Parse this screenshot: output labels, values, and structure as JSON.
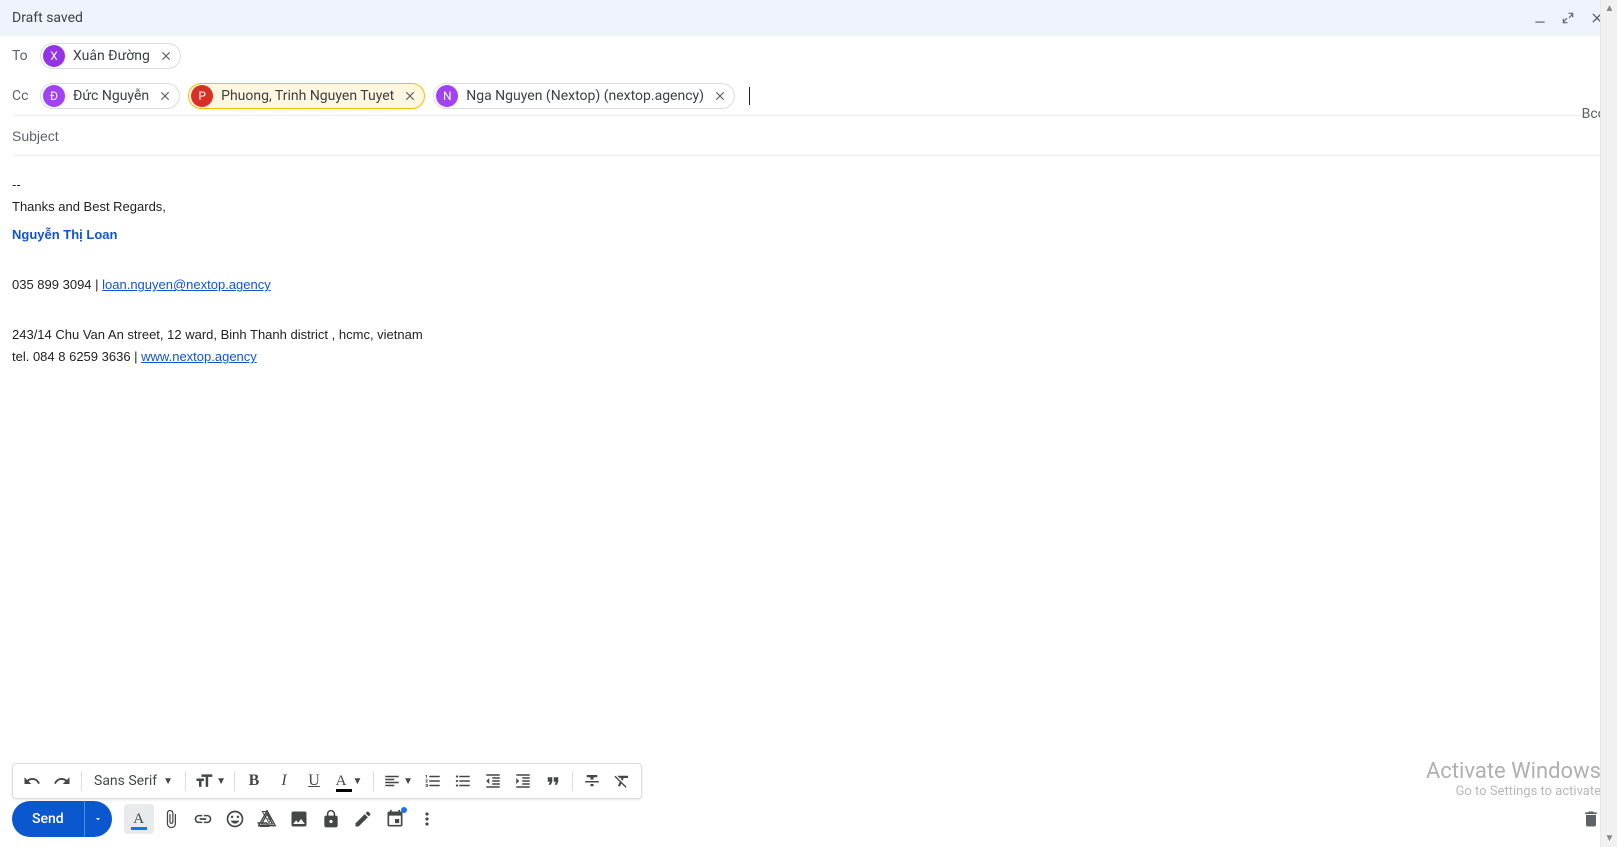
{
  "header": {
    "title": "Draft saved"
  },
  "to": {
    "label": "To",
    "chips": [
      {
        "initial": "X",
        "name": "Xuân Đường",
        "avatar_bg": "#9334e6"
      }
    ]
  },
  "cc": {
    "label": "Cc",
    "chips": [
      {
        "initial": "Đ",
        "name": "Đức Nguyễn",
        "avatar_bg": "#a142f4",
        "highlight": false
      },
      {
        "initial": "P",
        "name": "Phuong, Trinh Nguyen Tuyet",
        "avatar_bg": "#d93025",
        "highlight": true
      },
      {
        "initial": "N",
        "name": "Nga Nguyen (Nextop) (nextop.agency)",
        "avatar_bg": "#a142f4",
        "highlight": false
      }
    ]
  },
  "bcc_label": "Bcc",
  "subject_placeholder": "Subject",
  "signature": {
    "separator": "--",
    "regards": "Thanks and Best Regards,",
    "name": "Nguyễn Thị Loan",
    "phone": "035 899 3094",
    "pipe": "  | ",
    "email": "loan.nguyen@nextop.agency",
    "address": "243/14  Chu Van An street, 12 ward, Binh Thanh district , hcmc, vietnam",
    "tel_prefix": "tel. 084 8 6259 3636  | ",
    "website": "www.nextop.agency"
  },
  "format_toolbar": {
    "font": "Sans Serif"
  },
  "send_label": "Send",
  "watermark": {
    "line1": "Activate Windows",
    "line2": "Go to Settings to activate"
  }
}
